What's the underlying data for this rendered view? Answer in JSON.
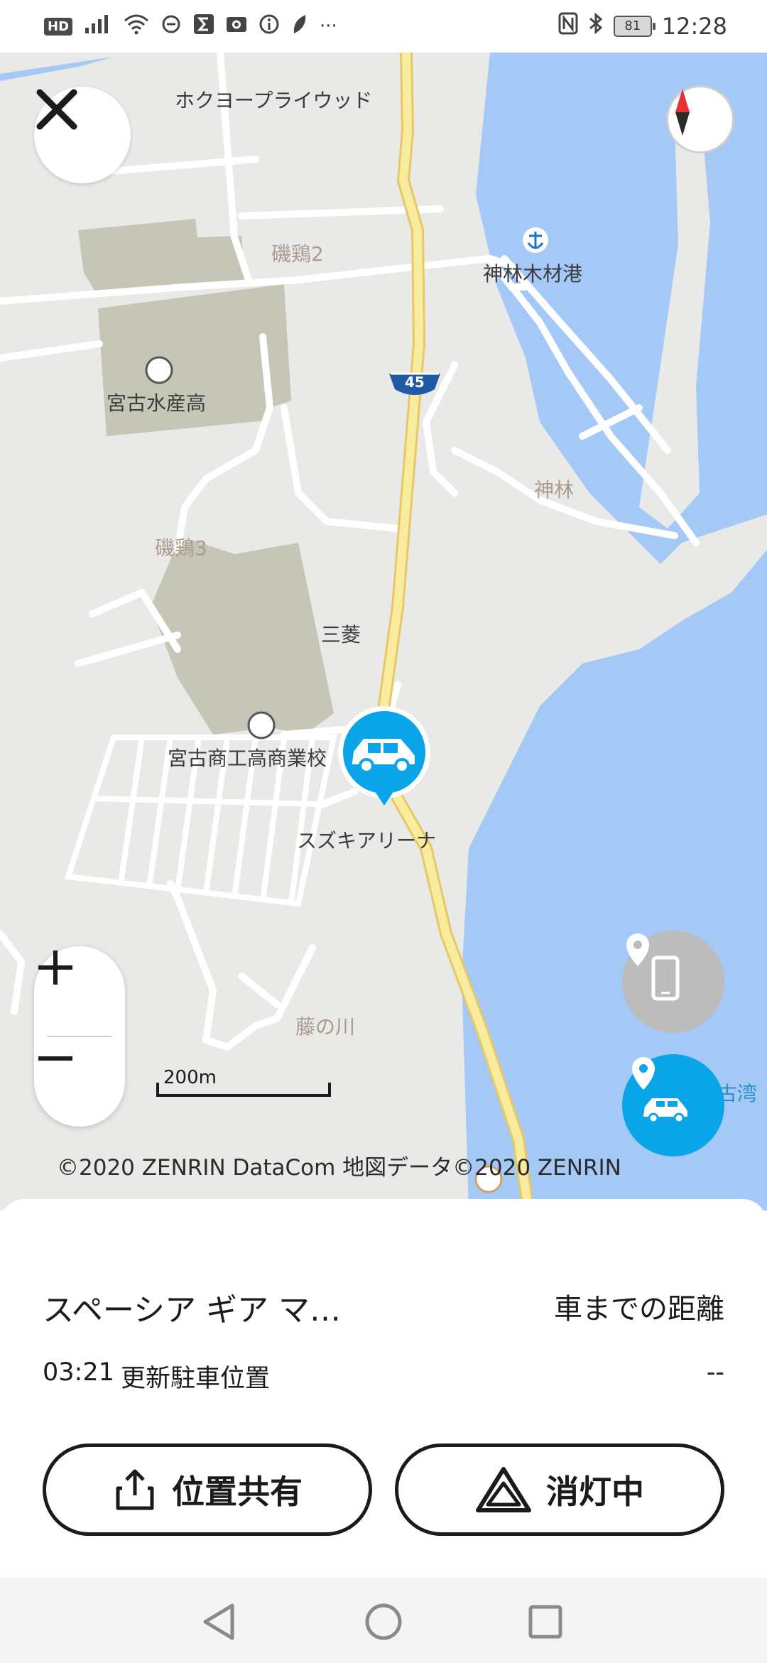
{
  "status_bar": {
    "hd": "HD",
    "battery": "81",
    "time": "12:28",
    "more": "···"
  },
  "map": {
    "labels": {
      "hokuyo": "ホクヨープライウッド",
      "isokei2": "磯鶏2",
      "kanbayashi_port": "神林木材港",
      "route45": "45",
      "miyako_suisan": "宮古水産高",
      "kanbayashi": "神林",
      "isokei3": "磯鶏3",
      "mitsubishi": "三菱",
      "miyako_shoko": "宮古商工高商業校",
      "suzuki_arena": "スズキアリーナ",
      "fujinokawa": "藤の川",
      "bay_fragment": "古湾"
    },
    "scale_label": "200m",
    "copyright": "©2020 ZENRIN DataCom 地図データ©2020 ZENRIN"
  },
  "icons": {
    "close": "close-icon",
    "compass": "compass-icon",
    "zoom_in": "plus-icon",
    "zoom_out": "minus-icon",
    "phone_location": "phone-location-icon",
    "car_location": "car-location-icon",
    "share": "share-icon",
    "hazard": "hazard-triangle-icon"
  },
  "colors": {
    "accent": "#0aa5e8",
    "water": "#a4c9f7",
    "road_major": "#f7e08a",
    "land": "#e9e9e7",
    "park": "#c6c6b7"
  },
  "sheet": {
    "car_name": "スペーシア ギア マ…",
    "distance_label": "車までの距離",
    "update_time": "03:21",
    "update_label": "更新駐車位置",
    "distance_value": "--",
    "share_label": "位置共有",
    "lights_label": "消灯中"
  }
}
